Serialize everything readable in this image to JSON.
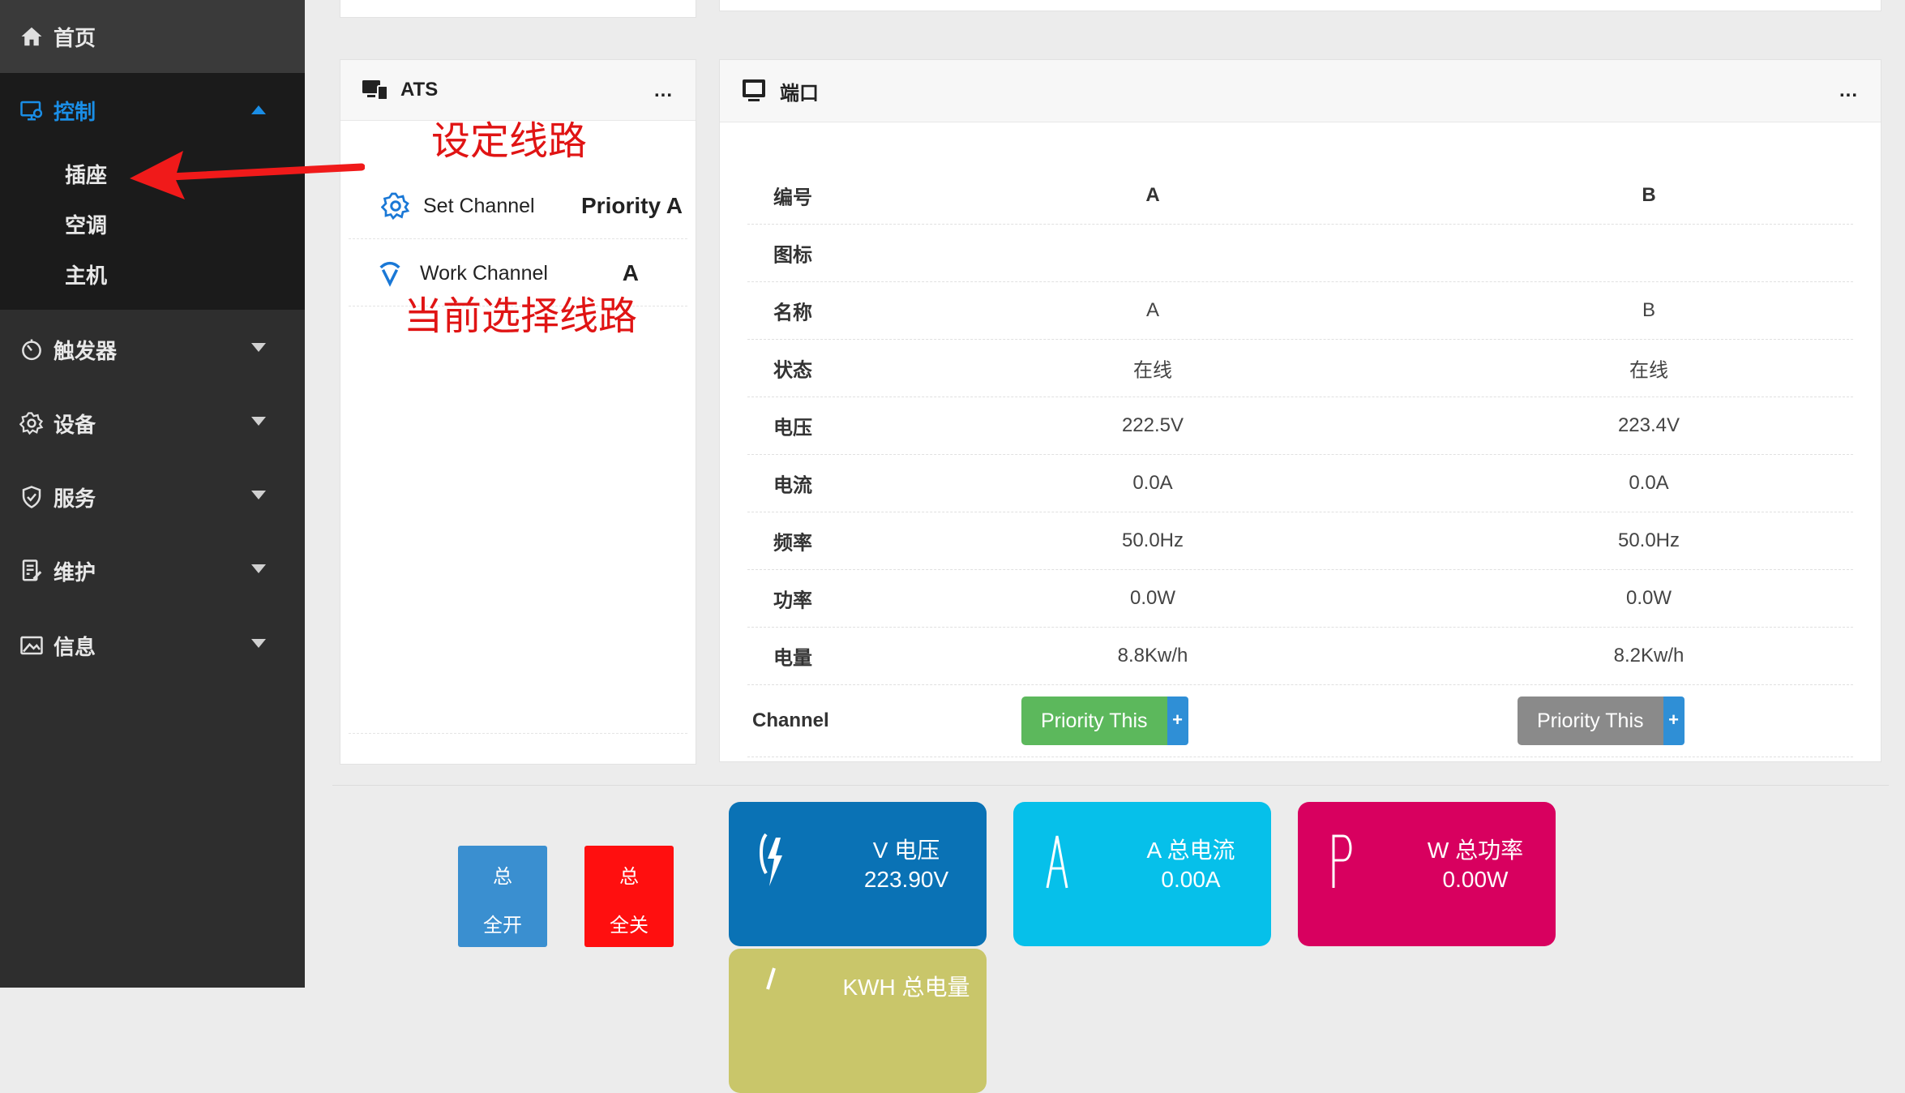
{
  "sidebar": {
    "home": "首页",
    "control": "控制",
    "control_sub": [
      "插座",
      "空调",
      "主机"
    ],
    "trigger": "触发器",
    "device": "设备",
    "service": "服务",
    "maintain": "维护",
    "info": "信息"
  },
  "ats": {
    "title": "ATS",
    "more": "...",
    "set_channel_label": "Set Channel",
    "set_channel_value": "Priority A",
    "work_channel_label": "Work Channel",
    "work_channel_value": "A"
  },
  "annotations": {
    "set_line": "设定线路",
    "current_line": "当前选择线路"
  },
  "port": {
    "title": "端口",
    "more": "...",
    "rows": [
      {
        "key": "编号",
        "a": "A",
        "b": "B"
      },
      {
        "key": "图标",
        "a": "",
        "b": ""
      },
      {
        "key": "名称",
        "a": "A",
        "b": "B"
      },
      {
        "key": "状态",
        "a": "在线",
        "b": "在线"
      },
      {
        "key": "电压",
        "a": "222.5V",
        "b": "223.4V"
      },
      {
        "key": "电流",
        "a": "0.0A",
        "b": "0.0A"
      },
      {
        "key": "频率",
        "a": "50.0Hz",
        "b": "50.0Hz"
      },
      {
        "key": "功率",
        "a": "0.0W",
        "b": "0.0W"
      },
      {
        "key": "电量",
        "a": "8.8Kw/h",
        "b": "8.2Kw/h"
      }
    ],
    "channel_label": "Channel",
    "priority_a": "Priority This",
    "priority_b": "Priority This",
    "plus": "+"
  },
  "totals": {
    "on_top": "总",
    "on_bottom": "全开",
    "off_top": "总",
    "off_bottom": "全关",
    "voltage_label": "V 电压",
    "voltage_value": "223.90V",
    "current_label": "A 总电流",
    "current_value": "0.00A",
    "power_label": "W 总功率",
    "power_value": "0.00W",
    "energy_label": "KWH 总电量"
  },
  "colors": {
    "sidebar_bg": "#2e2e2e",
    "accent_blue": "#1a8ee6",
    "btn_green": "#5cb85c",
    "btn_gray": "#8a8a8a",
    "tile_voltage": "#0a72b5",
    "tile_current": "#06c0ea",
    "tile_power": "#d8005f",
    "tile_energy": "#c9c66a",
    "btn_on": "#3a8fd0",
    "btn_off": "#ff0f0f",
    "annotation_red": "#e01414"
  }
}
